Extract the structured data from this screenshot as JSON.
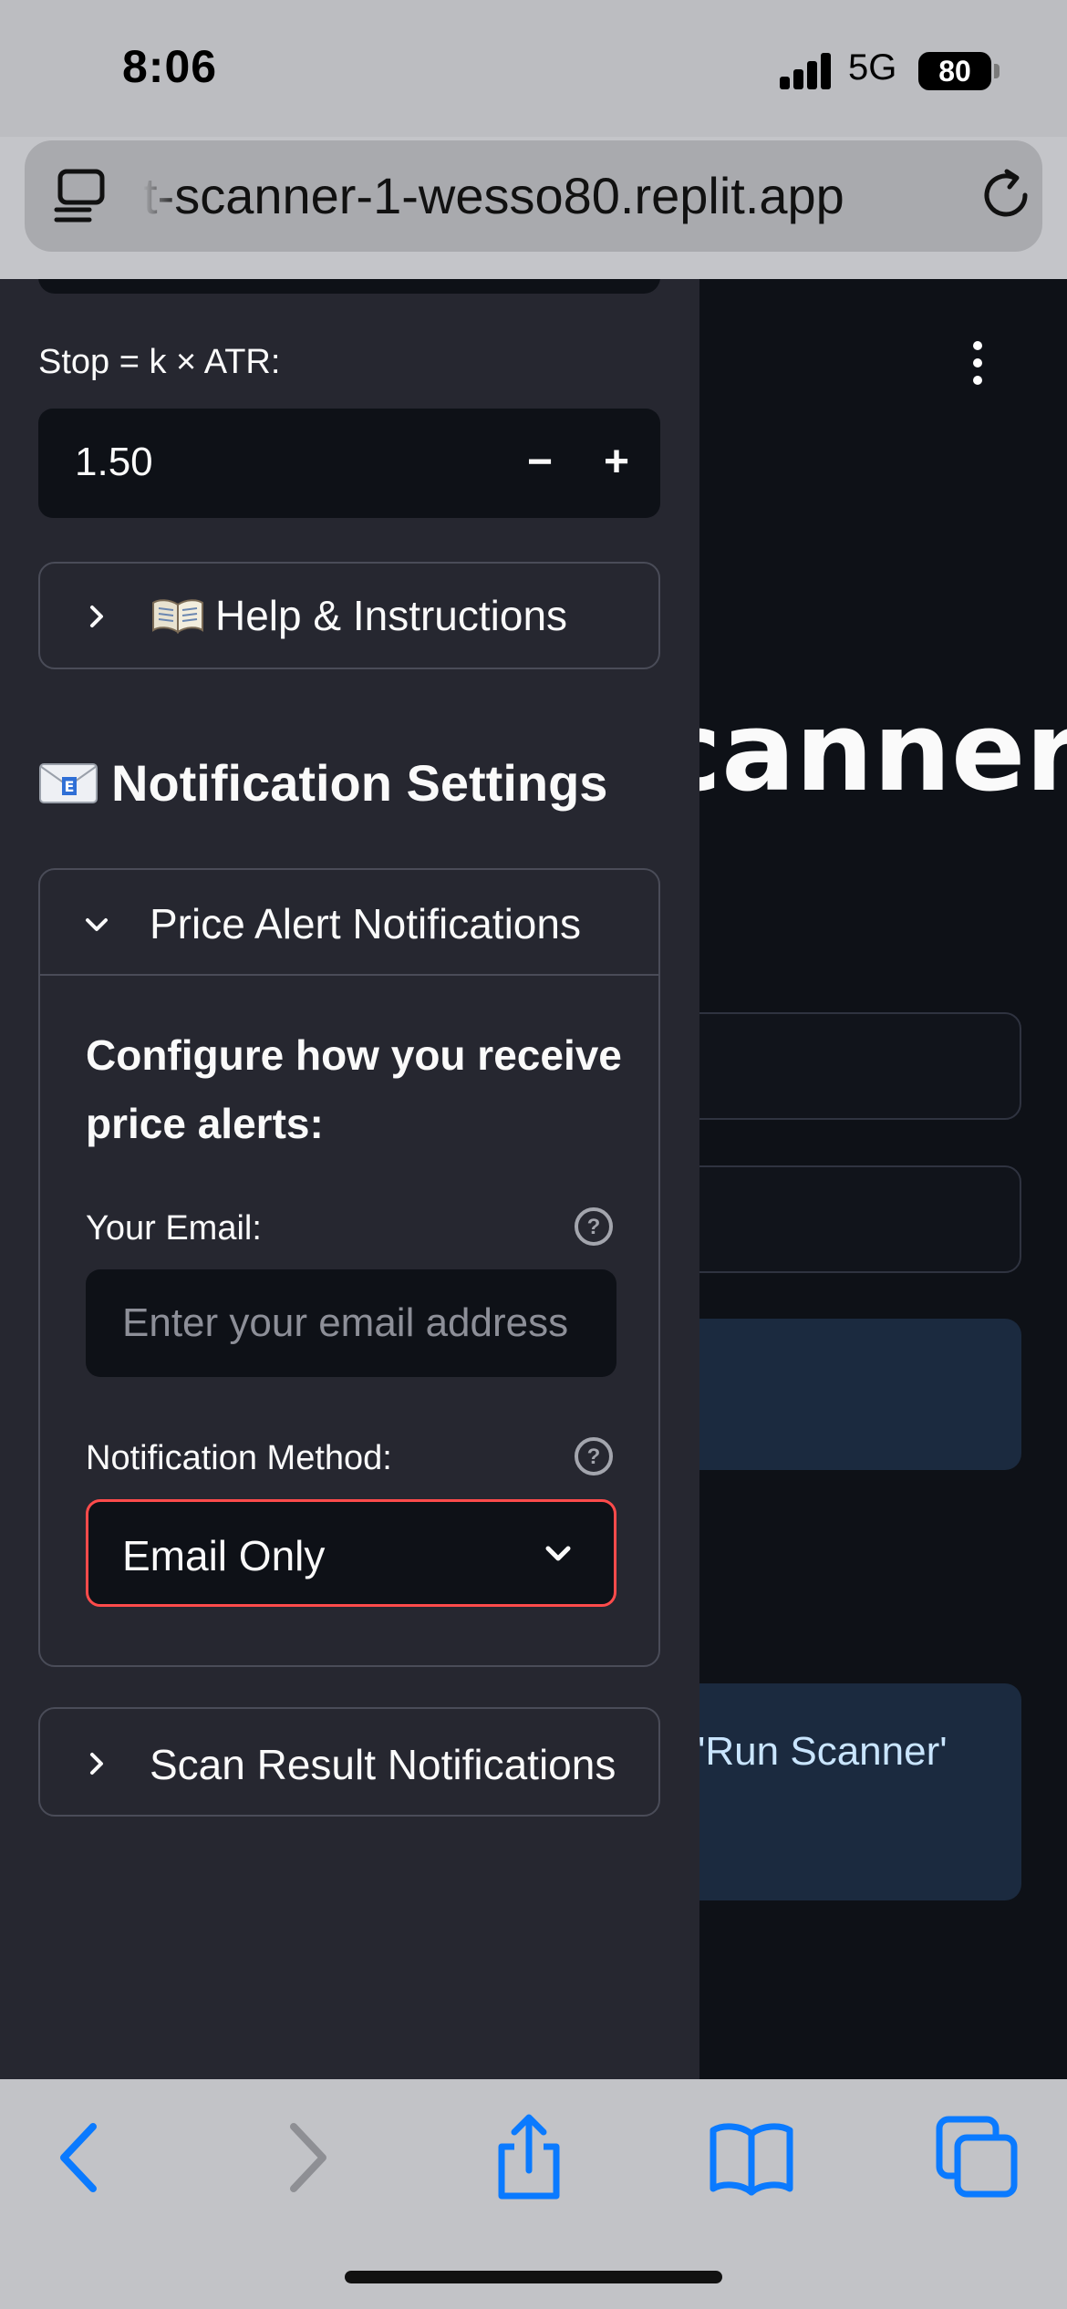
{
  "status_bar": {
    "time": "8:06",
    "network": "5G",
    "battery": "80"
  },
  "browser": {
    "url": "t-scanner-1-wesso80.replit.app",
    "icons": [
      "tabs-icon",
      "reload-icon"
    ]
  },
  "sidebar": {
    "stop_label": "Stop = k × ATR:",
    "stop_value": "1.50",
    "stepper_minus": "−",
    "stepper_plus": "+",
    "help_expander_label": "Help & Instructions",
    "notification_heading": "Notification Settings",
    "price_alert": {
      "label": "Price Alert Notifications",
      "configure_text": "Configure how you receive price alerts:",
      "email_label": "Your Email:",
      "email_placeholder": "Enter your email address",
      "method_label": "Notification Method:",
      "method_value": "Email Only"
    },
    "scan_result_label": "Scan Result Notifications"
  },
  "main": {
    "title_visible": "canner",
    "info_text_visible": "'Run Scanner'"
  },
  "colors": {
    "app_bg": "#0e1117",
    "sidebar_bg": "#262730",
    "accent_red": "#ff4b4b",
    "ios_blue": "#0a7aff",
    "info_bg": "#1b2a3f"
  },
  "toolbar_icons": [
    "back-icon",
    "forward-icon",
    "share-icon",
    "bookmarks-icon",
    "tabs-overview-icon"
  ]
}
